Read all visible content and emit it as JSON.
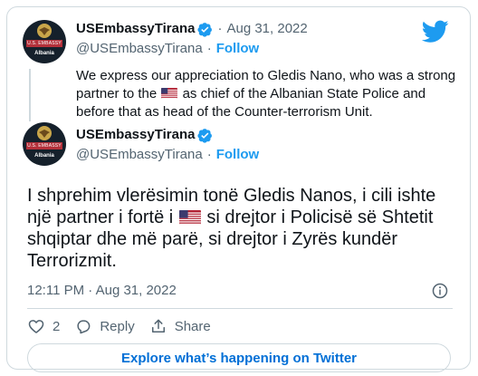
{
  "quoted_tweet": {
    "avatar_banner": "U.S. EMBASSY",
    "avatar_country": "Albania",
    "display_name": "USEmbassyTirana",
    "date": "Aug 31, 2022",
    "handle": "@USEmbassyTirana",
    "follow_label": "Follow",
    "text_part1": "We express our appreciation to Gledis Nano, who was a strong partner to the",
    "text_part2": "as chief of the Albanian State Police and before that as head of the Counter-terrorism Unit."
  },
  "main_tweet": {
    "avatar_banner": "U.S. EMBASSY",
    "avatar_country": "Albania",
    "display_name": "USEmbassyTirana",
    "handle": "@USEmbassyTirana",
    "follow_label": "Follow",
    "text_part1": "I shprehim vlerësimin tonë Gledis Nanos, i cili ishte një partner i fortë i",
    "text_part2": "si drejtor i Policisë së Shtetit shqiptar dhe më parë, si drejtor i Zyrës kundër Terrorizmit.",
    "timestamp": "12:11 PM · Aug 31, 2022"
  },
  "actions": {
    "like_count": "2",
    "reply_label": "Reply",
    "share_label": "Share"
  },
  "explore_label": "Explore what’s happening on Twitter",
  "icons": {
    "brand": "twitter-bird-icon",
    "verified": "verified-badge-icon",
    "flag": "us-flag-emoji",
    "like": "heart-icon",
    "reply": "reply-bubble-icon",
    "share": "share-icon",
    "info": "info-icon"
  },
  "colors": {
    "accent": "#1d9bf0",
    "text": "#0f1419",
    "muted": "#536471",
    "border": "#cfd9de",
    "link": "#006fd6"
  }
}
